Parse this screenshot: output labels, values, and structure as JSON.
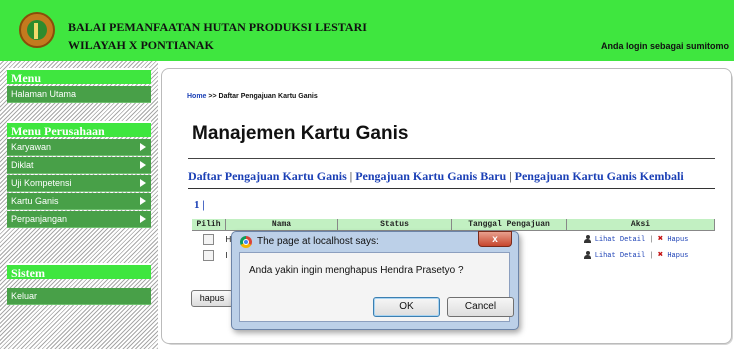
{
  "header": {
    "title_line1": "BALAI PEMANFAATAN HUTAN PRODUKSI LESTARI",
    "title_line2": "WILAYAH X PONTIANAK",
    "login_info": "Anda login sebagai sumitomo",
    "bg_color": "#3fe63f"
  },
  "sidebar": {
    "menu_head": "Menu",
    "menu_items": [
      {
        "label": "Halaman Utama"
      }
    ],
    "perusahaan_head": "Menu Perusahaan",
    "perusahaan_items": [
      {
        "label": "Karyawan"
      },
      {
        "label": "Diklat"
      },
      {
        "label": "Uji Kompetensi"
      },
      {
        "label": "Kartu Ganis"
      },
      {
        "label": "Perpanjangan"
      }
    ],
    "sistem_head": "Sistem",
    "sistem_items": [
      {
        "label": "Keluar"
      }
    ]
  },
  "main": {
    "breadcrumb_home": "Home",
    "breadcrumb_rest": " >> Daftar Pengajuan Kartu Ganis",
    "title": "Manajemen Kartu Ganis",
    "links": [
      {
        "label": "Daftar Pengajuan Kartu Ganis"
      },
      {
        "label": "Pengajuan Kartu Ganis Baru"
      },
      {
        "label": "Pengajuan Kartu Ganis Kembali"
      }
    ],
    "link_sep": " | ",
    "pager": "1 |",
    "table": {
      "headers": [
        "Pilih",
        "Nama",
        "Status",
        "Tanggal Pengajuan",
        "Aksi"
      ],
      "rows": [
        {
          "name_initial": "H",
          "detail": "Lihat Detail",
          "sep": "|",
          "delete": "Hapus"
        },
        {
          "name_initial": "I",
          "detail": "Lihat Detail",
          "sep": "|",
          "delete": "Hapus"
        }
      ]
    },
    "delete_button": "hapus"
  },
  "dialog": {
    "title": "The page at localhost says:",
    "close": "x",
    "message": "Anda yakin ingin menghapus Hendra Prasetyo ?",
    "ok": "OK",
    "cancel": "Cancel"
  }
}
